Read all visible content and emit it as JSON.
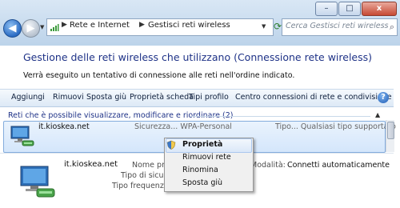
{
  "window": {
    "minimize": "–",
    "maximize": "□",
    "close": "x"
  },
  "address": {
    "crumbs": [
      "Rete e Internet",
      "Gestisci reti wireless"
    ],
    "separator": "▶"
  },
  "search": {
    "placeholder": "Cerca Gestisci reti wireless"
  },
  "header": {
    "title": "Gestione delle reti wireless che utilizzano (Connessione rete wireless)",
    "description": "Verrà eseguito un tentativo di connessione alle reti nell'ordine indicato."
  },
  "toolbar": {
    "add": "Aggiungi",
    "remove": "Rimuovi",
    "move_down": "Sposta giù",
    "properties": "Proprietà scheda",
    "profile_type": "Tipi profilo",
    "network_center": "Centro connessioni di rete e condivisione",
    "help": "?"
  },
  "group": {
    "title": "Reti che è possibile visualizzare, modificare e riordinare (2)",
    "toggle": "▲"
  },
  "network": {
    "name": "it.kioskea.net",
    "security": "Sicurezza... WPA-Personal",
    "type": "Tipo... Qualsiasi tipo supportato"
  },
  "details": {
    "name": "it.kioskea.net",
    "labels": [
      "Nome pro",
      "Tipo di sicure",
      "Tipo frequenza ra"
    ],
    "mode_label": "Modalità:",
    "mode_value": "Connetti automaticamente"
  },
  "context_menu": {
    "items": [
      "Proprietà",
      "Rimuovi rete",
      "Rinomina",
      "Sposta giù"
    ]
  }
}
